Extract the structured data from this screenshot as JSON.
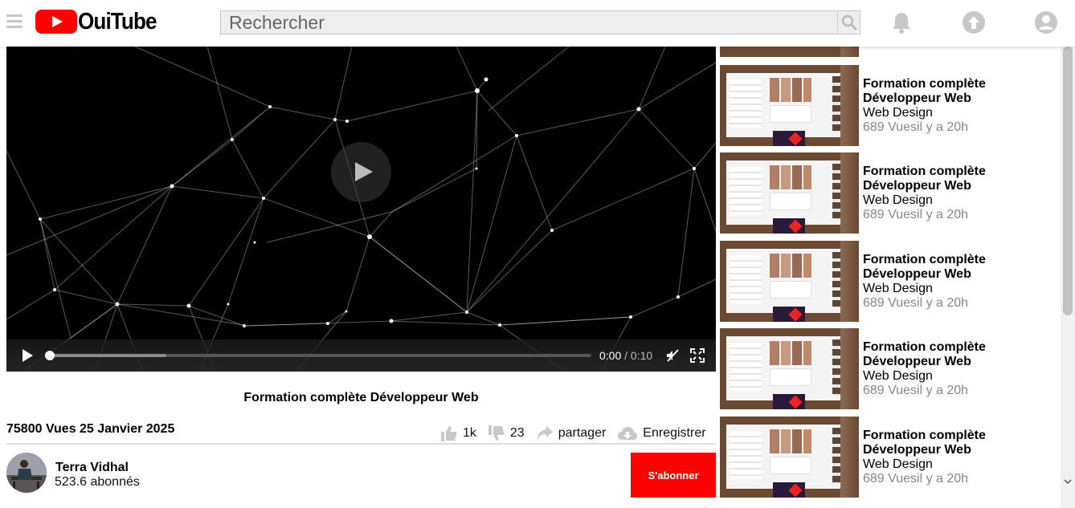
{
  "app": {
    "logo_text": "OuiTube",
    "search_placeholder": "Rechercher",
    "brand_color": "#ff0000"
  },
  "header": {
    "icons": [
      "menu-icon",
      "search-icon",
      "bell-icon",
      "upload-icon",
      "account-icon"
    ]
  },
  "player": {
    "current_time": "0:00",
    "separator": "/",
    "duration": "0:10",
    "progress": 0.0,
    "buffered": 0.22
  },
  "video": {
    "title": "Formation complète Développeur Web",
    "views_date": "75800 Vues 25 Janvier 2025",
    "likes": "1k",
    "dislikes": "23",
    "share_label": "partager",
    "save_label": "Enregistrer"
  },
  "channel": {
    "name": "Terra Vidhal",
    "subscribers": "523.6 abonnés",
    "subscribe_label": "S'abonner"
  },
  "sidebar": {
    "items": [
      {
        "title": "Formation complète Développeur Web",
        "channel": "Web Design",
        "meta": "689 Vuesil y a 20h"
      },
      {
        "title": "Formation complète Développeur Web",
        "channel": "Web Design",
        "meta": "689 Vuesil y a 20h"
      },
      {
        "title": "Formation complète Développeur Web",
        "channel": "Web Design",
        "meta": "689 Vuesil y a 20h"
      },
      {
        "title": "Formation complète Développeur Web",
        "channel": "Web Design",
        "meta": "689 Vuesil y a 20h"
      },
      {
        "title": "Formation complète Développeur Web",
        "channel": "Web Design",
        "meta": "689 Vuesil y a 20h"
      }
    ]
  }
}
